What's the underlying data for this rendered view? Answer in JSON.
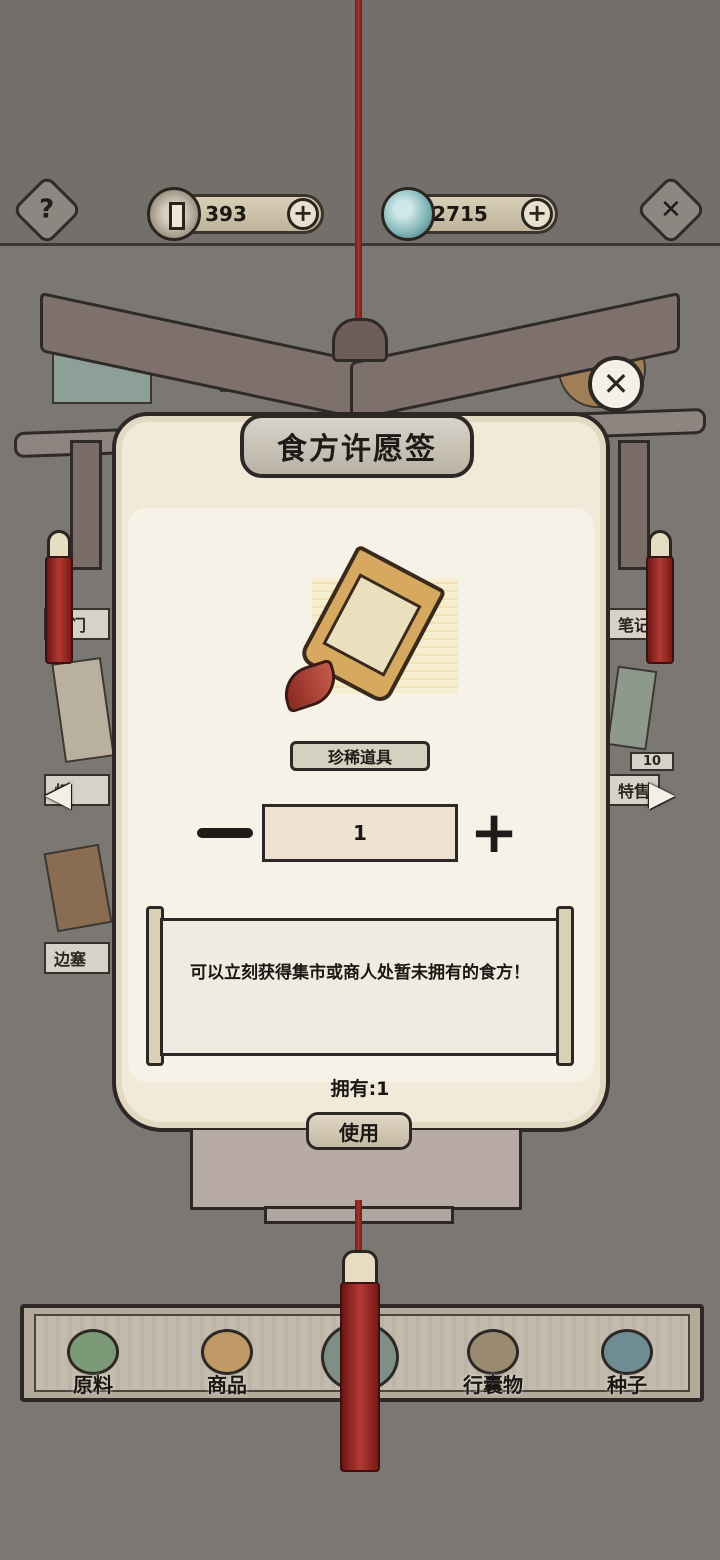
{
  "hud": {
    "help_icon": "question-icon",
    "close_icon": "close-icon",
    "copper_coins": "393",
    "jade": "2715",
    "add_symbol": "+"
  },
  "background": {
    "left_tags": [
      "关门",
      "灯",
      "边塞"
    ],
    "right_tags": [
      "笔记",
      "特售"
    ],
    "count_badge": "10"
  },
  "dialog": {
    "title": "食方许愿签",
    "close_symbol": "✕",
    "rarity": "珍稀道具",
    "quantity": "1",
    "minus_symbol": "",
    "plus_symbol": "+",
    "description": "可以立刻获得集市或商人处暂未拥有的食方！",
    "owned_label": "拥有:1",
    "use_button": "使用"
  },
  "nav": {
    "left_arrow": "◀",
    "right_arrow": "▶"
  },
  "tabs": [
    {
      "label": "原料",
      "icon": "leaf-icon"
    },
    {
      "label": "商品",
      "icon": "food-tray-icon"
    },
    {
      "label": "",
      "icon": "recipe-icon"
    },
    {
      "label": "行囊物",
      "icon": "clothing-icon"
    },
    {
      "label": "种子",
      "icon": "seed-bag-icon"
    }
  ],
  "colors": {
    "background": "#7b7873",
    "panel": "#f1ead9",
    "cord_red": "#a8312d",
    "outline": "#2d2825"
  }
}
